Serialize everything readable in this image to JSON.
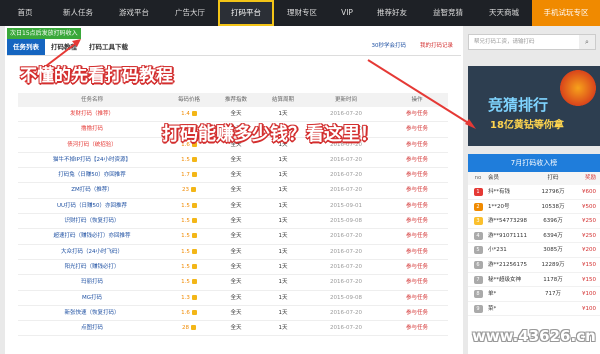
{
  "nav": {
    "items": [
      "首页",
      "新人任务",
      "游戏平台",
      "广告大厅",
      "打码平台",
      "理财专区",
      "VIP",
      "推荐好友",
      "益智竞猜",
      "天天商城",
      "手机试玩专区"
    ],
    "active": "打码平台"
  },
  "notice": "次日15点后发放打码收入",
  "tabs": [
    "任务列表",
    "打码教程",
    "打码工具下载"
  ],
  "help_links": [
    "30秒学会打码",
    "我的打码记录"
  ],
  "table": {
    "headers": [
      "任务名称",
      "每码价格",
      "推荐指数",
      "结算周期",
      "更新时间",
      "操作"
    ],
    "rows": [
      [
        "发财打码（推荐）",
        "1.4",
        "全天",
        "1天",
        "2016-07-20",
        "参与任务"
      ],
      [
        "撸撸打码",
        "1.5",
        "全天",
        "1天",
        "2016-07-20",
        "参与任务"
      ],
      [
        "债河打码（统招验）",
        "1.6",
        "全天",
        "1天",
        "2016-07-20",
        "参与任务"
      ],
      [
        "猫牛不掉IP打码【24小时资源】",
        "1.5",
        "全天",
        "1天",
        "2016-07-20",
        "参与任务"
      ],
      [
        "打码兔（日赚50）亦回推荐",
        "1.7",
        "全天",
        "1天",
        "2016-07-20",
        "参与任务"
      ],
      [
        "ZM打码（推荐）",
        "23",
        "全天",
        "1天",
        "2016-07-20",
        "参与任务"
      ],
      [
        "UU打码（日赚50）亦回推荐",
        "1.5",
        "全天",
        "1天",
        "2015-09-01",
        "参与任务"
      ],
      [
        "识财打码（恢复打码）",
        "1.5",
        "全天",
        "1天",
        "2015-09-08",
        "参与任务"
      ],
      [
        "超速打码（赚钱必打）亦回推荐",
        "1.5",
        "全天",
        "1天",
        "2016-07-20",
        "参与任务"
      ],
      [
        "大众打码（24小时飞码）",
        "1.5",
        "全天",
        "1天",
        "2016-07-20",
        "参与任务"
      ],
      [
        "阳光打码（赚钱必打）",
        "1.5",
        "全天",
        "1天",
        "2016-07-20",
        "参与任务"
      ],
      [
        "玛丽打码",
        "1.5",
        "全天",
        "1天",
        "2016-07-20",
        "参与任务"
      ],
      [
        "MG打码",
        "1.3",
        "全天",
        "1天",
        "2015-09-08",
        "参与任务"
      ],
      [
        "新张快速（恢复打码）",
        "1.6",
        "全天",
        "1天",
        "2016-07-20",
        "参与任务"
      ],
      [
        "点图打码",
        "28",
        "全天",
        "1天",
        "2016-07-20",
        "参与任务"
      ]
    ]
  },
  "search": {
    "placeholder": "帮兄打码工资，请输打码"
  },
  "banner": {
    "title": "竞猜排行",
    "subtitle": "18亿黄钻等你拿"
  },
  "rank": {
    "title": "7月打码收入榜",
    "headers": [
      "no",
      "会员",
      "打码",
      "奖励"
    ],
    "rows": [
      [
        "1",
        "抖**有钱",
        "12796万",
        "¥600"
      ],
      [
        "2",
        "1**20号",
        "10538万",
        "¥500"
      ],
      [
        "3",
        "游**54773298",
        "6396万",
        "¥250"
      ],
      [
        "4",
        "游**91071111",
        "6394万",
        "¥250"
      ],
      [
        "5",
        "小*231",
        "3085万",
        "¥200"
      ],
      [
        "6",
        "游**21256175",
        "12289万",
        "¥150"
      ],
      [
        "7",
        "秘**超级女神",
        "1178万",
        "¥150"
      ],
      [
        "8",
        "单*",
        "717万",
        "¥100"
      ],
      [
        "9",
        "菜*",
        "",
        "¥100"
      ]
    ]
  },
  "overlays": {
    "tip1": "不懂的先看打码教程",
    "tip2": "打码能赚多少钱？看这里！",
    "watermark": "www.43626.cn"
  },
  "colors": {
    "nav_bg": "#1e2126",
    "active_border": "#f3c417",
    "hot": "#f08a00",
    "accent_blue": "#1f7ddb",
    "red": "#d32f2f"
  }
}
